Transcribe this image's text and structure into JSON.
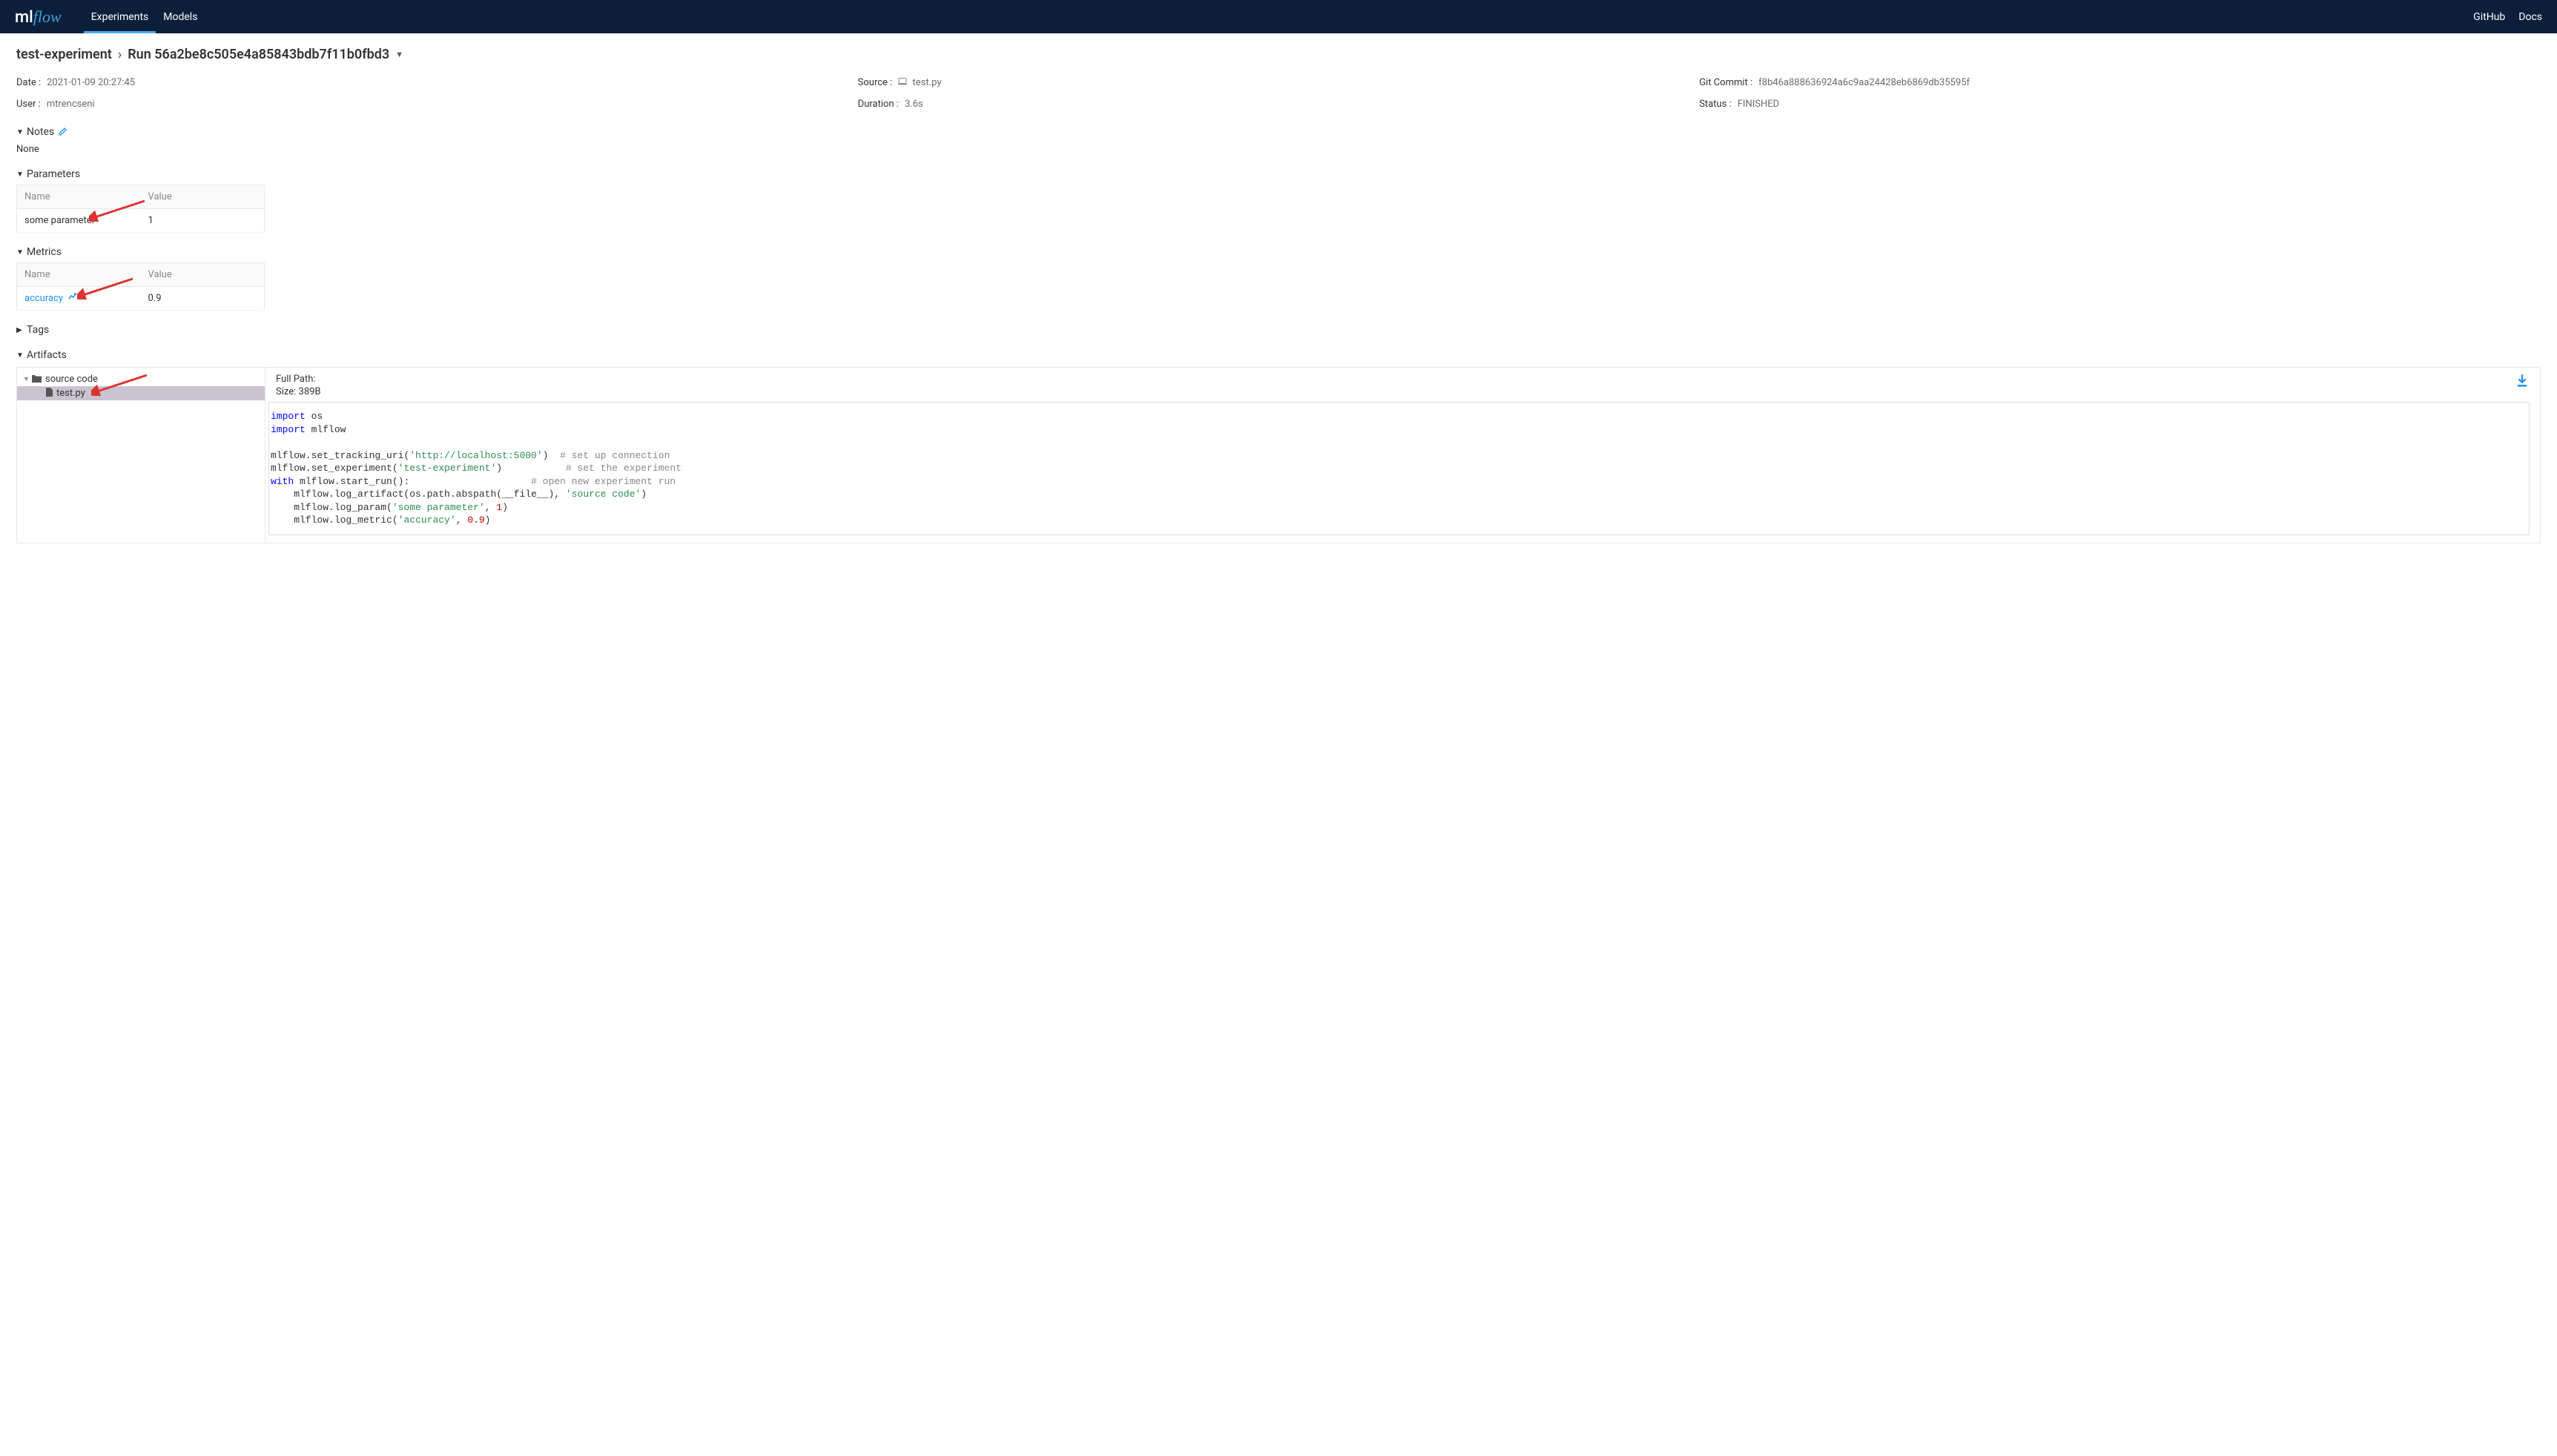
{
  "nav": {
    "logo_ml": "ml",
    "logo_flow": "flow",
    "experiments": "Experiments",
    "models": "Models",
    "github": "GitHub",
    "docs": "Docs"
  },
  "breadcrumb": {
    "experiment": "test-experiment",
    "run": "Run 56a2be8c505e4a85843bdb7f11b0fbd3"
  },
  "meta": {
    "date_label": "Date :",
    "date_value": "2021-01-09 20:27:45",
    "source_label": "Source :",
    "source_value": "test.py",
    "git_label": "Git Commit :",
    "git_value": "f8b46a888636924a6c9aa24428eb6869db35595f",
    "user_label": "User :",
    "user_value": "mtrencseni",
    "duration_label": "Duration :",
    "duration_value": "3.6s",
    "status_label": "Status :",
    "status_value": "FINISHED"
  },
  "sections": {
    "notes": "Notes",
    "notes_none": "None",
    "parameters": "Parameters",
    "metrics": "Metrics",
    "tags": "Tags",
    "artifacts": "Artifacts"
  },
  "table_headers": {
    "name": "Name",
    "value": "Value"
  },
  "parameters": {
    "row0_name": "some parameter",
    "row0_value": "1"
  },
  "metrics": {
    "row0_name": "accuracy",
    "row0_value": "0.9"
  },
  "artifacts": {
    "folder": "source code",
    "file": "test.py",
    "fullpath_label": "Full Path:",
    "size_label": "Size:",
    "size_value": "389B"
  },
  "code": {
    "l1a": "import",
    "l1b": " os",
    "l2a": "import",
    "l2b": " mlflow",
    "l4a": "mlflow.set_tracking_uri(",
    "l4b": "'http://localhost:5000'",
    "l4c": ")  ",
    "l4d": "# set up connection",
    "l5a": "mlflow.set_experiment(",
    "l5b": "'test-experiment'",
    "l5c": ")           ",
    "l5d": "# set the experiment",
    "l6a": "with",
    "l6b": " mlflow.start_run():                     ",
    "l6c": "# open new experiment run",
    "l7a": "    mlflow.log_artifact(os.path.abspath(__file__), ",
    "l7b": "'source code'",
    "l7c": ")",
    "l8a": "    mlflow.log_param(",
    "l8b": "'some parameter'",
    "l8c": ", ",
    "l8d": "1",
    "l8e": ")",
    "l9a": "    mlflow.log_metric(",
    "l9b": "'accuracy'",
    "l9c": ", ",
    "l9d": "0.9",
    "l9e": ")"
  }
}
